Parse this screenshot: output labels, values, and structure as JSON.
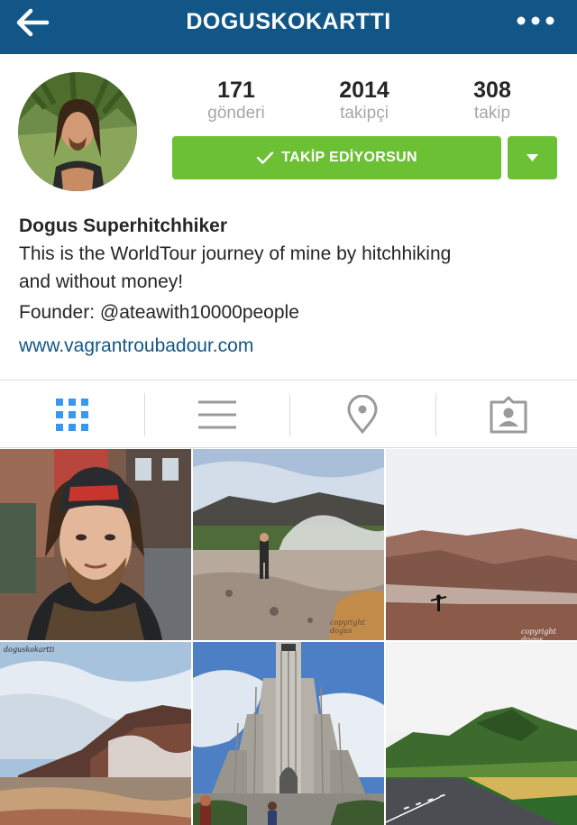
{
  "header": {
    "username": "DOGUSKOKARTTI",
    "back_icon": "arrow-left-icon",
    "more_icon": "more-dots-icon",
    "bar_color": "#125688"
  },
  "stats": [
    {
      "value": "171",
      "label": "gönderi"
    },
    {
      "value": "2014",
      "label": "takipçi"
    },
    {
      "value": "308",
      "label": "takip"
    }
  ],
  "follow": {
    "label": "TAKİP EDİYORSUN",
    "check_icon": "checkmark-icon",
    "dropdown_icon": "caret-down-icon",
    "color": "#6bc133"
  },
  "bio": {
    "name": "Dogus Superhitchhiker",
    "line1": "This is the WorldTour journey of mine by hitchhiking",
    "line2": "and without money!",
    "line3": "Founder: @ateawith10000people",
    "website": "www.vagrantroubadour.com",
    "link_color": "#125688"
  },
  "tabs": [
    {
      "name": "grid",
      "icon": "grid-icon",
      "active": true
    },
    {
      "name": "list",
      "icon": "list-icon",
      "active": false
    },
    {
      "name": "map",
      "icon": "location-pin-icon",
      "active": false
    },
    {
      "name": "tagged",
      "icon": "tagged-person-icon",
      "active": false
    }
  ],
  "posts": [
    {
      "subject": "selfie-street",
      "watermark": ""
    },
    {
      "subject": "geyser-field",
      "watermark": "copyright dogus"
    },
    {
      "subject": "red-hills-man",
      "watermark": "copyright dogus"
    },
    {
      "subject": "steam-valley",
      "watermark": "doguskokartti"
    },
    {
      "subject": "cathedral-tower",
      "watermark": ""
    },
    {
      "subject": "green-mountain-road",
      "watermark": ""
    }
  ]
}
